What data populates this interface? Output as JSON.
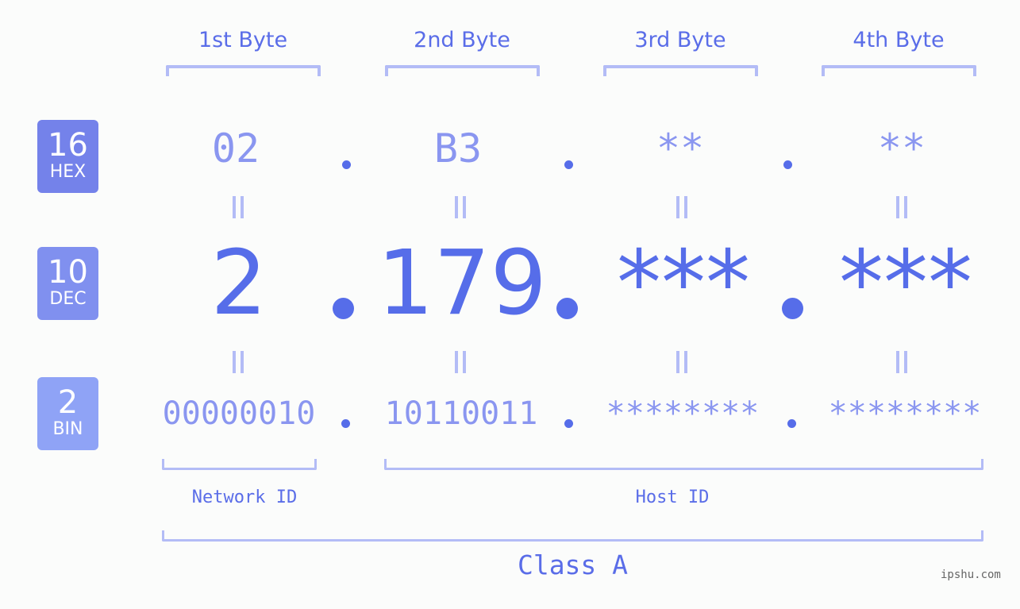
{
  "bytes": [
    {
      "header": "1st Byte",
      "hex": "02",
      "dec": "2",
      "bin": "00000010"
    },
    {
      "header": "2nd Byte",
      "hex": "B3",
      "dec": "179",
      "bin": "10110011"
    },
    {
      "header": "3rd Byte",
      "hex": "**",
      "dec": "***",
      "bin": "********"
    },
    {
      "header": "4th Byte",
      "hex": "**",
      "dec": "***",
      "bin": "********"
    }
  ],
  "badges": {
    "hex": {
      "num": "16",
      "label": "HEX",
      "color": "#7482ea"
    },
    "dec": {
      "num": "10",
      "label": "DEC",
      "color": "#8090ef"
    },
    "bin": {
      "num": "2",
      "label": "BIN",
      "color": "#8fa3f6"
    }
  },
  "labels": {
    "network_id": "Network ID",
    "host_id": "Host ID",
    "class": "Class A"
  },
  "watermark": "ipshu.com",
  "colors": {
    "accent": "#566de9",
    "light_value": "#8a96f0",
    "bracket": "#b3bcf6",
    "background": "#fbfcfb"
  }
}
